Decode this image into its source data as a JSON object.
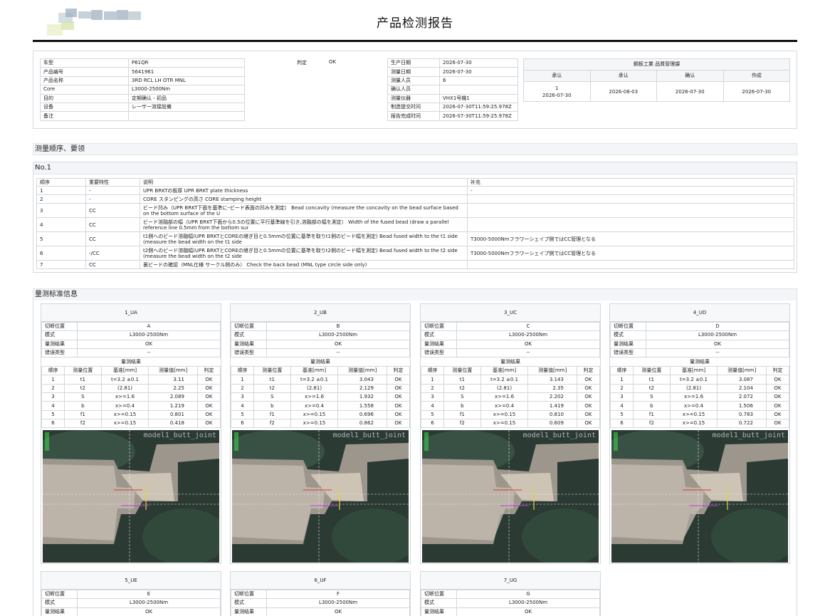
{
  "title": "产品检测报告",
  "info_left": [
    {
      "k": "车型",
      "v": "P61QR"
    },
    {
      "k": "产品编号",
      "v": "5641961"
    },
    {
      "k": "产品名称",
      "v": "3RD RCL LH OTR MNL"
    },
    {
      "k": "Core",
      "v": "L3000-2500Nm"
    },
    {
      "k": "目的",
      "v": "定期确认 - 初品"
    },
    {
      "k": "设备",
      "v": "レーザー溶接設備"
    },
    {
      "k": "备注",
      "v": ""
    }
  ],
  "judgement": {
    "label": "判定",
    "value": "OK"
  },
  "info_right": [
    {
      "k": "生产日期",
      "v": "2026-07-30"
    },
    {
      "k": "测量日期",
      "v": "2026-07-30"
    },
    {
      "k": "测量人员",
      "v": "6"
    },
    {
      "k": "确认人员",
      "v": ""
    },
    {
      "k": "测量仪器",
      "v": "VHX1号機1"
    },
    {
      "k": "制造提交时间",
      "v": "2026-07-30T11:59:25.978Z"
    },
    {
      "k": "报告完成时间",
      "v": "2026-07-30T11:59:25.978Z"
    }
  ],
  "approval": {
    "header": "鋼板工業  品質管理課",
    "cols": [
      "承认",
      "承认",
      "确认",
      "作成"
    ],
    "row": [
      [
        "1",
        "2026-07-30"
      ],
      [
        "",
        "2026-08-03"
      ],
      [
        "",
        "2026-07-30"
      ],
      [
        "",
        "2026-07-30"
      ]
    ]
  },
  "sec1_title": "测量顺序、要领",
  "sec1_sub": "No.1",
  "seq_headers": [
    "顺序",
    "重要特性",
    "说明",
    "补充"
  ],
  "seq_rows": [
    [
      "1",
      "-",
      "UPR BRKTの板厚 UPR BRKT plate thickness",
      "-"
    ],
    [
      "2",
      "-",
      "CORE スタンピングの高さ CORE stamping height",
      ""
    ],
    [
      "3",
      "CC",
      "ビード凹み（UPR BRKT下面を基準にｰビード表面の凹みを測定） Bead concavity (measure the concavity on the bead surface based on the bottom surface of the U",
      ""
    ],
    [
      "4",
      "CC",
      "ビード溶融部の幅（UPR BRKT下面から0.5の位置に平行基準線を引き,溶融部の幅を測定） Width of the fused bead (draw a parallel reference line 0.5mm from the bottom sur",
      ""
    ],
    [
      "5",
      "CC",
      "t1側へのビード溶融幅(UPR BRKTとCOREの継ぎ目と0.5mmの位置に基準を取りt1側のビード幅を測定) Bead fused width to the t1 side (measure the bead width on the t1 side",
      "T3000-5000Nmフラワーシェイプ側ではCC管理となる"
    ],
    [
      "6",
      "-/CC",
      "t2側へのビード溶融幅(UPR BRKTとCOREの継ぎ目と0.5mmの位置に基準を取りt2側のビード幅を測定) Bead fused width to the t2 side (measure the bead width on the t2 side",
      "T3000-5000Nmフラワーシェイプ側ではCC管理となる"
    ],
    [
      "7",
      "CC",
      "裏ビードの確認（MNL仕様 サークル側のみ） Check the back bead (MNL type circle side only)",
      ""
    ]
  ],
  "sec2_title": "量测标准信息",
  "card_labels": {
    "pos": "切断位置",
    "model": "模式",
    "result": "量测结果",
    "err": "错误类型",
    "sub": "量测结果",
    "h": [
      "顺序",
      "测量位置",
      "基准[mm]",
      "测量值[mm]",
      "判定"
    ],
    "watermark": "model1_butt_joint"
  },
  "cards": [
    {
      "name": "1_UA",
      "pos": "A",
      "model": "L3000-2500Nm",
      "result": "OK",
      "err": "--",
      "rows": [
        [
          "1",
          "t1",
          "t=3.2 ±0.1",
          "3.11",
          "OK"
        ],
        [
          "2",
          "t2",
          "(2.81)",
          "2.25",
          "OK"
        ],
        [
          "3",
          "S",
          "x>=1.6",
          "2.089",
          "OK"
        ],
        [
          "4",
          "b",
          "x>=0.4",
          "1.219",
          "OK"
        ],
        [
          "5",
          "f1",
          "x>=0.15",
          "0.801",
          "OK"
        ],
        [
          "6",
          "f2",
          "x>=0.15",
          "0.418",
          "OK"
        ]
      ]
    },
    {
      "name": "2_UB",
      "pos": "B",
      "model": "L3000-2500Nm",
      "result": "OK",
      "err": "--",
      "rows": [
        [
          "1",
          "t1",
          "t=3.2 ±0.1",
          "3.043",
          "OK"
        ],
        [
          "2",
          "t2",
          "(2.81)",
          "2.129",
          "OK"
        ],
        [
          "3",
          "S",
          "x>=1.6",
          "1.932",
          "OK"
        ],
        [
          "4",
          "b",
          "x>=0.4",
          "1.558",
          "OK"
        ],
        [
          "5",
          "f1",
          "x>=0.15",
          "0.696",
          "OK"
        ],
        [
          "6",
          "f2",
          "x>=0.15",
          "0.862",
          "OK"
        ]
      ]
    },
    {
      "name": "3_UC",
      "pos": "C",
      "model": "L3000-2500Nm",
      "result": "OK",
      "err": "--",
      "rows": [
        [
          "1",
          "t1",
          "t=3.2 ±0.1",
          "3.143",
          "OK"
        ],
        [
          "2",
          "t2",
          "(2.81)",
          "2.35",
          "OK"
        ],
        [
          "3",
          "S",
          "x>=1.6",
          "2.202",
          "OK"
        ],
        [
          "4",
          "b",
          "x>=0.4",
          "1.419",
          "OK"
        ],
        [
          "5",
          "f1",
          "x>=0.15",
          "0.810",
          "OK"
        ],
        [
          "6",
          "f2",
          "x>=0.15",
          "0.609",
          "OK"
        ]
      ]
    },
    {
      "name": "4_UD",
      "pos": "D",
      "model": "L3000-2500Nm",
      "result": "OK",
      "err": "--",
      "rows": [
        [
          "1",
          "t1",
          "t=3.2 ±0.1",
          "3.087",
          "OK"
        ],
        [
          "2",
          "t2",
          "(2.81)",
          "2.104",
          "OK"
        ],
        [
          "3",
          "S",
          "x>=1.6",
          "2.072",
          "OK"
        ],
        [
          "4",
          "b",
          "x>=0.4",
          "1.506",
          "OK"
        ],
        [
          "5",
          "f1",
          "x>=0.15",
          "0.783",
          "OK"
        ],
        [
          "6",
          "f2",
          "x>=0.15",
          "0.722",
          "OK"
        ]
      ]
    }
  ],
  "cards2": [
    {
      "name": "5_UE",
      "pos": "E",
      "model": "L3000-2500Nm",
      "result": "OK"
    },
    {
      "name": "6_UF",
      "pos": "F",
      "model": "L3000-2500Nm",
      "result": "OK"
    },
    {
      "name": "7_UG",
      "pos": "G",
      "model": "L3000-2500Nm",
      "result": "OK"
    }
  ]
}
